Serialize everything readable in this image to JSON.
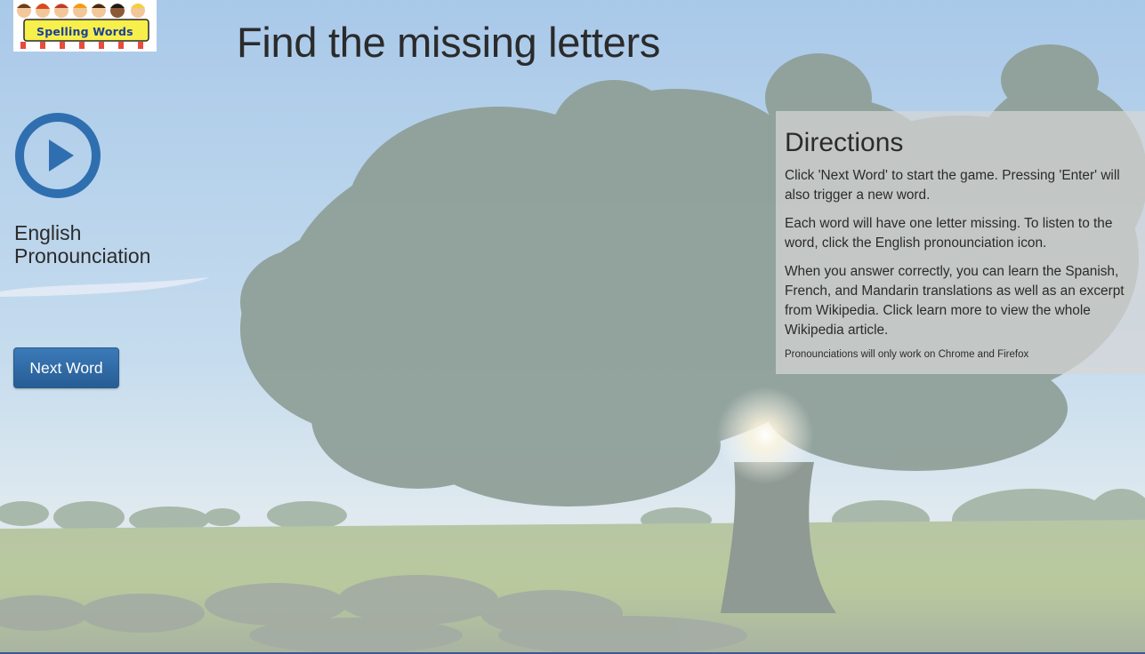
{
  "header": {
    "logo_text": "Spelling Words",
    "title": "Find the missing letters"
  },
  "sidebar": {
    "pronunciation_label": "English Pronounciation",
    "next_word_label": "Next Word"
  },
  "directions": {
    "heading": "Directions",
    "paragraphs": [
      "Click 'Next Word' to start the game. Pressing 'Enter' will also trigger a new word.",
      "Each word will have one letter missing. To listen to the word, click the English pronounciation icon.",
      "When you answer correctly, you can learn the Spanish, French, and Mandarin translations as well as an excerpt from Wikipedia. Click learn more to view the whole Wikipedia article."
    ],
    "note": "Pronounciations will only work on Chrome and Firefox"
  },
  "colors": {
    "accent": "#2f6fb0",
    "button_bg": "#2f6aa6",
    "panel_bg": "#d6d6d6"
  },
  "icons": {
    "play": "play-circle-icon"
  }
}
